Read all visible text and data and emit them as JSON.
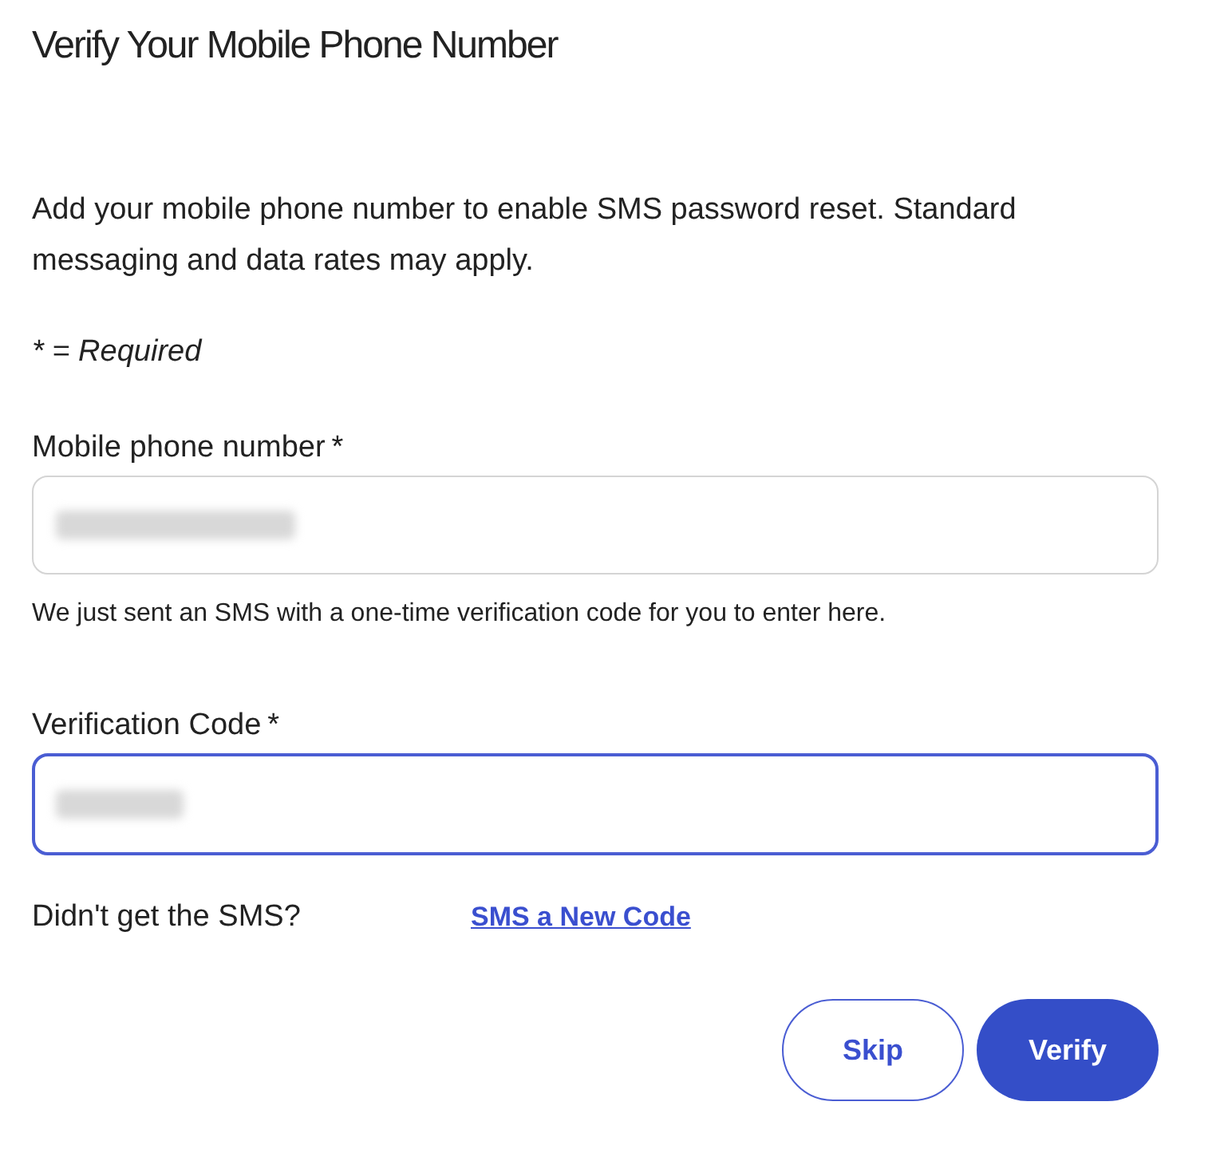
{
  "title": "Verify Your Mobile Phone Number",
  "intro": "Add your mobile phone number to enable SMS password reset. Standard messaging and data rates may apply.",
  "required_note": "* = Required",
  "fields": [
    {
      "label": "Mobile phone number",
      "required_mark": "*",
      "focused": false,
      "helper": "We just sent an SMS with a one-time verification code for you to enter here."
    },
    {
      "label": "Verification Code",
      "required_mark": "*",
      "focused": true
    }
  ],
  "resend": {
    "prompt": "Didn't get the SMS?",
    "link": "SMS a New Code"
  },
  "buttons": [
    {
      "label": "Skip",
      "kind": "secondary"
    },
    {
      "label": "Verify",
      "kind": "primary"
    }
  ]
}
